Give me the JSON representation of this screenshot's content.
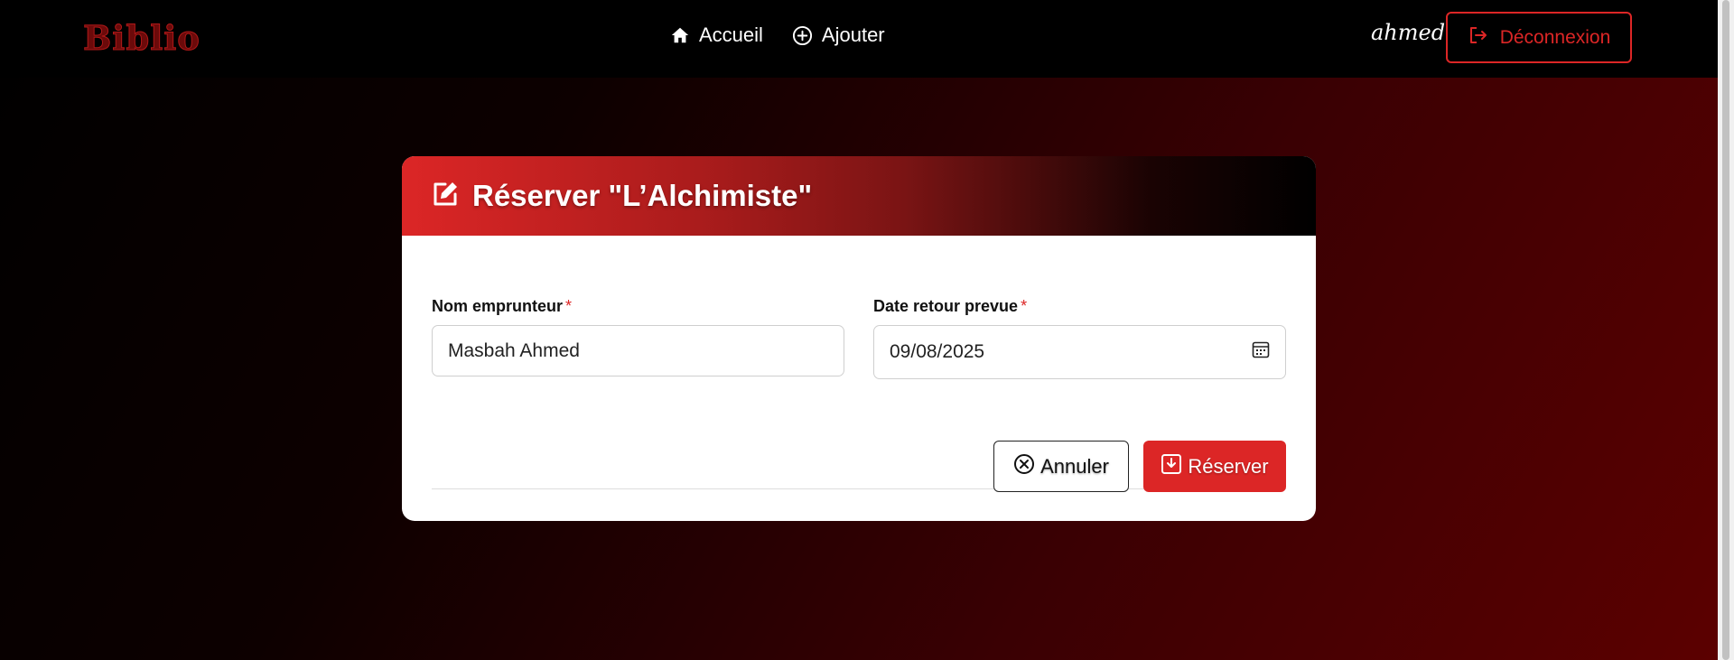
{
  "navbar": {
    "brand": "Biblio",
    "links": [
      {
        "label": "Accueil",
        "icon": "home-icon"
      },
      {
        "label": "Ajouter",
        "icon": "plus-circle-icon"
      }
    ],
    "username": "ahmed",
    "logout_label": "Déconnexion"
  },
  "form": {
    "title": "Réserver \"L’Alchimiste\"",
    "borrower": {
      "label": "Nom emprunteur",
      "required_mark": "*",
      "value": "Masbah Ahmed"
    },
    "return_date": {
      "label": "Date retour prevue",
      "required_mark": "*",
      "value": "09/08/2025"
    },
    "cancel_label": "Annuler",
    "submit_label": "Réserver"
  },
  "colors": {
    "accent": "#dc2626",
    "brand": "#6b0a0a",
    "navbar_bg": "#000000"
  }
}
